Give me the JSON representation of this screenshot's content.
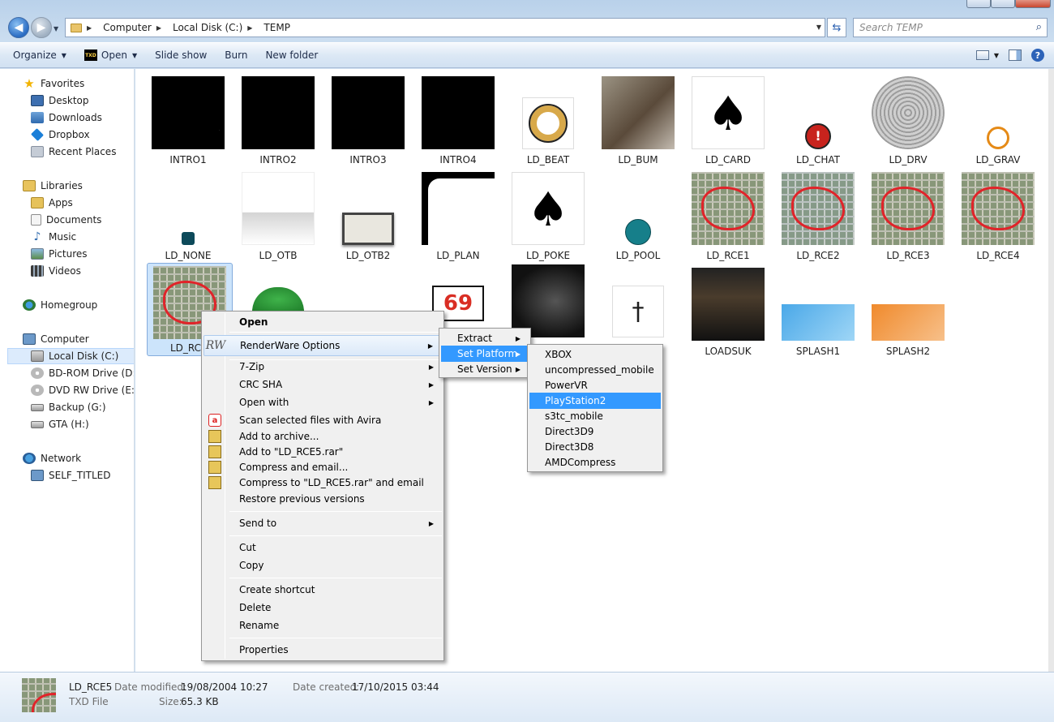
{
  "address": {
    "crumbs": [
      "Computer",
      "Local Disk (C:)",
      "TEMP"
    ],
    "search_placeholder": "Search TEMP"
  },
  "toolbar": {
    "organize": "Organize",
    "open": "Open",
    "slideshow": "Slide show",
    "burn": "Burn",
    "new_folder": "New folder"
  },
  "nav": {
    "favorites": "Favorites",
    "desktop": "Desktop",
    "downloads": "Downloads",
    "dropbox": "Dropbox",
    "recent": "Recent Places",
    "libraries": "Libraries",
    "apps": "Apps",
    "documents": "Documents",
    "music": "Music",
    "pictures": "Pictures",
    "videos": "Videos",
    "homegroup": "Homegroup",
    "computer": "Computer",
    "local_disk": "Local Disk (C:)",
    "bdrom": "BD-ROM Drive (D:) S",
    "dvdrw": "DVD RW Drive (E:) V.",
    "backup": "Backup (G:)",
    "gta": "GTA (H:)",
    "network": "Network",
    "self_titled": "SELF_TITLED"
  },
  "files": {
    "intro1": "INTRO1",
    "intro2": "INTRO2",
    "intro3": "INTRO3",
    "intro4": "INTRO4",
    "ld_beat": "LD_BEAT",
    "ld_bum": "LD_BUM",
    "ld_card": "LD_CARD",
    "ld_chat": "LD_CHAT",
    "ld_drv": "LD_DRV",
    "ld_grav": "LD_GRAV",
    "ld_none": "LD_NONE",
    "ld_otb": "LD_OTB",
    "ld_otb2": "LD_OTB2",
    "ld_plan": "LD_PLAN",
    "ld_poke": "LD_POKE",
    "ld_pool": "LD_POOL",
    "ld_rce1": "LD_RCE1",
    "ld_rce2": "LD_RCE2",
    "ld_rce3": "LD_RCE3",
    "ld_rce4": "LD_RCE4",
    "ld_rce5": "LD_RCE",
    "loadsuk": "LOADSUK",
    "splash1": "SPLASH1",
    "splash2": "SPLASH2"
  },
  "context_menu": {
    "open": "Open",
    "renderware": "RenderWare Options",
    "zip": "7-Zip",
    "crc": "CRC SHA",
    "open_with": "Open with",
    "avira": "Scan selected files with Avira",
    "add_archive": "Add to archive...",
    "add_rar": "Add to \"LD_RCE5.rar\"",
    "compress_email": "Compress and email...",
    "compress_rar_email": "Compress to \"LD_RCE5.rar\" and email",
    "restore": "Restore previous versions",
    "send_to": "Send to",
    "cut": "Cut",
    "copy": "Copy",
    "create_shortcut": "Create shortcut",
    "delete": "Delete",
    "rename": "Rename",
    "properties": "Properties"
  },
  "rw_menu": {
    "extract": "Extract",
    "set_platform": "Set Platform",
    "set_version": "Set Version"
  },
  "platform_menu": {
    "items": [
      "XBOX",
      "uncompressed_mobile",
      "PowerVR",
      "PlayStation2",
      "s3tc_mobile",
      "Direct3D9",
      "Direct3D8",
      "AMDCompress"
    ],
    "highlighted": "PlayStation2"
  },
  "details": {
    "name": "LD_RCE5",
    "type": "TXD File",
    "modified_label": "Date modified:",
    "modified": "19/08/2004 10:27",
    "size_label": "Size:",
    "size": "65.3 KB",
    "created_label": "Date created:",
    "created": "17/10/2015 03:44"
  }
}
